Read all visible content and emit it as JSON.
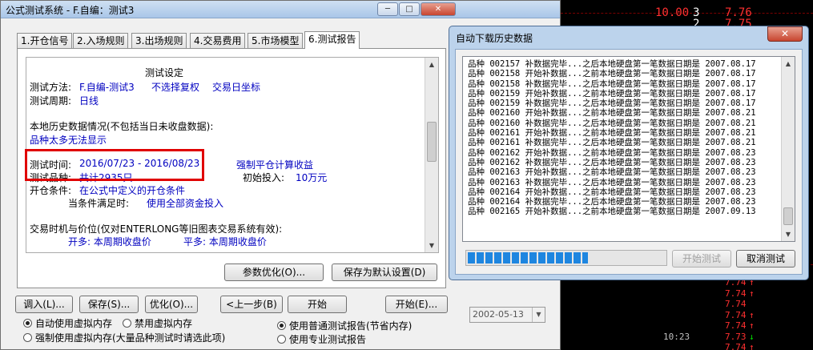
{
  "main_window": {
    "title": "公式测试系统 - F.自编：测试3",
    "controls": {
      "minimize": "─",
      "maximize": "□",
      "close": "✕"
    }
  },
  "tabs": [
    {
      "label": "1.开仓信号"
    },
    {
      "label": "2.入场规则"
    },
    {
      "label": "3.出场规则"
    },
    {
      "label": "4.交易费用"
    },
    {
      "label": "5.市场模型"
    },
    {
      "label": "6.测试报告",
      "active": true
    }
  ],
  "report": {
    "heading": "测试设定",
    "method_label": "测试方法:",
    "method_value": "F.自编-测试3",
    "method_extra1": "不选择复权",
    "method_extra2": "交易日坐标",
    "period_label": "测试周期:",
    "period_value": "日线",
    "history_label": "本地历史数据情况(不包括当日未收盘数据):",
    "history_value": "品种太多无法显示",
    "time_label": "测试时间:",
    "time_value": "2016/07/23 - 2016/08/23",
    "force_close": "强制平仓计算收益",
    "symbols_label": "测试品种:",
    "symbols_value": "共计2935只",
    "initial_label": "初始投入:",
    "initial_value": "10万元",
    "open_label": "开仓条件:",
    "open_value": "在公式中定义的开仓条件",
    "when_label": "当条件满足时:",
    "when_value": "使用全部资金投入",
    "trade_timing": "交易时机与价位(仅对ENTERLONG等旧图表交易系统有效):",
    "open_long": "开多: 本周期收盘价",
    "close_long": "平多: 本周期收盘价"
  },
  "buttons": {
    "optimize_params": "参数优化(O)...",
    "save_default": "保存为默认设置(D)",
    "import": "调入(L)...",
    "save": "保存(S)...",
    "optimize": "优化(O)...",
    "prev": "<上一步(B)",
    "start": "开始",
    "start2": "开始(E)..."
  },
  "radios": {
    "auto_vm": "自动使用虚拟内存",
    "disable_vm": "禁用虚拟内存",
    "force_vm": "强制使用虚拟内存(大量品种测试时请选此项)",
    "normal_report": "使用普通测试报告(节省内存)",
    "pro_report": "使用专业测试报告"
  },
  "date_box": "2002-05-13",
  "download_dialog": {
    "title": "自动下载历史数据",
    "close": "✕",
    "progress": 0.61,
    "log": [
      "品种 002157 补数据完毕...之后本地硬盘第一笔数据日期是 2007.08.17",
      "品种 002158 开始补数据...之前本地硬盘第一笔数据日期是 2007.08.17",
      "品种 002158 补数据完毕...之后本地硬盘第一笔数据日期是 2007.08.17",
      "品种 002159 开始补数据...之前本地硬盘第一笔数据日期是 2007.08.17",
      "品种 002159 补数据完毕...之后本地硬盘第一笔数据日期是 2007.08.17",
      "品种 002160 开始补数据...之前本地硬盘第一笔数据日期是 2007.08.21",
      "品种 002160 补数据完毕...之后本地硬盘第一笔数据日期是 2007.08.21",
      "品种 002161 开始补数据...之前本地硬盘第一笔数据日期是 2007.08.21",
      "品种 002161 补数据完毕...之后本地硬盘第一笔数据日期是 2007.08.21",
      "品种 002162 开始补数据...之前本地硬盘第一笔数据日期是 2007.08.23",
      "品种 002162 补数据完毕...之后本地硬盘第一笔数据日期是 2007.08.23",
      "品种 002163 开始补数据...之前本地硬盘第一笔数据日期是 2007.08.23",
      "品种 002163 补数据完毕...之后本地硬盘第一笔数据日期是 2007.08.23",
      "品种 002164 开始补数据...之前本地硬盘第一笔数据日期是 2007.08.23",
      "品种 002164 补数据完毕...之后本地硬盘第一笔数据日期是 2007.08.23",
      "品种 002165 开始补数据...之前本地硬盘第一笔数据日期是 2007.09.13"
    ],
    "start_test": "开始测试",
    "cancel_test": "取消测试"
  },
  "stock_panel": {
    "top_price": "10.00",
    "top_count1": "3",
    "top_count2": "2",
    "top_val1": "7.76",
    "top_val2": "7.75",
    "quotes": [
      {
        "time": "",
        "price": "7.74",
        "arrow": "↑",
        "dir": "up"
      },
      {
        "time": "",
        "price": "7.74",
        "arrow": "↑",
        "dir": "up"
      },
      {
        "time": "",
        "price": "7.74",
        "arrow": "",
        "dir": "up"
      },
      {
        "time": "",
        "price": "7.74",
        "arrow": "↑",
        "dir": "up"
      },
      {
        "time": "",
        "price": "7.74",
        "arrow": "↑",
        "dir": "up"
      },
      {
        "time": "10:23",
        "price": "7.73",
        "arrow": "↓",
        "dir": "down"
      },
      {
        "time": "",
        "price": "7.74",
        "arrow": "↑",
        "dir": "up"
      }
    ],
    "colors": {
      "up": "#ff3030",
      "down": "#00e000",
      "grid": "#7a0000"
    }
  }
}
